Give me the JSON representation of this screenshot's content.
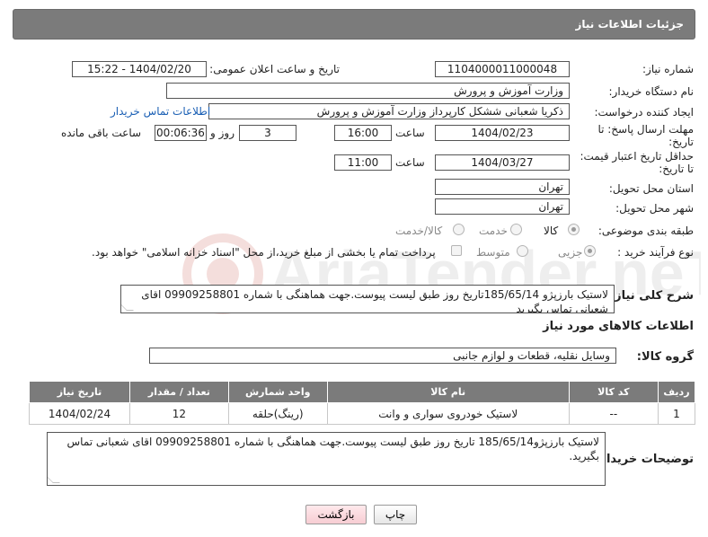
{
  "header": {
    "title": "جزئیات اطلاعات نیاز"
  },
  "form": {
    "need_number_label": "شماره نیاز:",
    "need_number": "1104000011000048",
    "announce_label": "تاریخ و ساعت اعلان عمومی:",
    "announce_value": "1404/02/20 - 15:22",
    "buyer_org_label": "نام دستگاه خریدار:",
    "buyer_org": "وزارت آموزش و پرورش",
    "creator_label": "ایجاد کننده درخواست:",
    "creator": "ذکریا شعبانی ششکل کارپرداز وزارت آموزش و پرورش",
    "contact_link": "اطلاعات تماس خریدار",
    "deadline_label_1": "مهلت ارسال پاسخ: تا",
    "deadline_label_2": "تاریخ:",
    "deadline_date": "1404/02/23",
    "time_label": "ساعت",
    "deadline_time": "16:00",
    "days_value": "3",
    "days_label": "روز و",
    "remaining_time": "00:06:36",
    "remaining_label": "ساعت باقی مانده",
    "validity_label_1": "حداقل تاریخ اعتبار قیمت:",
    "validity_label_2": "تا تاریخ:",
    "validity_date": "1404/03/27",
    "validity_time_label": "ساعت",
    "validity_time": "11:00",
    "province_label": "استان محل تحویل:",
    "province": "تهران",
    "city_label": "شهر محل تحویل:",
    "city": "تهران",
    "category_label": "طبقه بندی موضوعی:",
    "category_options": [
      "کالا",
      "خدمت",
      "کالا/خدمت"
    ],
    "process_label": "نوع فرآیند خرید :",
    "process_options": [
      "جزیی",
      "متوسط"
    ],
    "payment_note": "پرداخت تمام یا بخشی از مبلغ خرید،از محل \"اسناد خزانه اسلامی\" خواهد بود."
  },
  "description": {
    "label": "شرح کلی نیاز:",
    "text": "لاستیک بارزپژو 185/65/14تاریخ روز طبق لیست پیوست.جهت هماهنگی با شماره 09909258801 اقای شعبانی تماس بگیرید"
  },
  "goods": {
    "section_title": "اطلاعات کالاهای مورد نیاز",
    "group_label": "گروه کالا:",
    "group_value": "وسایل نقلیه، قطعات و لوازم جانبی",
    "columns": [
      "ردیف",
      "کد کالا",
      "نام کالا",
      "واحد شمارش",
      "تعداد / مقدار",
      "تاریخ نیاز"
    ],
    "rows": [
      [
        "1",
        "--",
        "لاستیک خودروی سواری و وانت",
        "(رینگ)حلقه",
        "12",
        "1404/02/24"
      ]
    ]
  },
  "buyer_notes": {
    "label": "توضیحات خریدار:",
    "text": "لاستیک بارزپژو185/65/14 تاریخ روز طبق لیست پیوست.جهت هماهنگی با شماره 09909258801 اقای شعبانی تماس بگیرید."
  },
  "buttons": {
    "print": "چاپ",
    "back": "بازگشت"
  },
  "colors": {
    "header_bg": "#7b7b7b",
    "link": "#1a5fb4",
    "back_button": "#f7cdd3"
  }
}
